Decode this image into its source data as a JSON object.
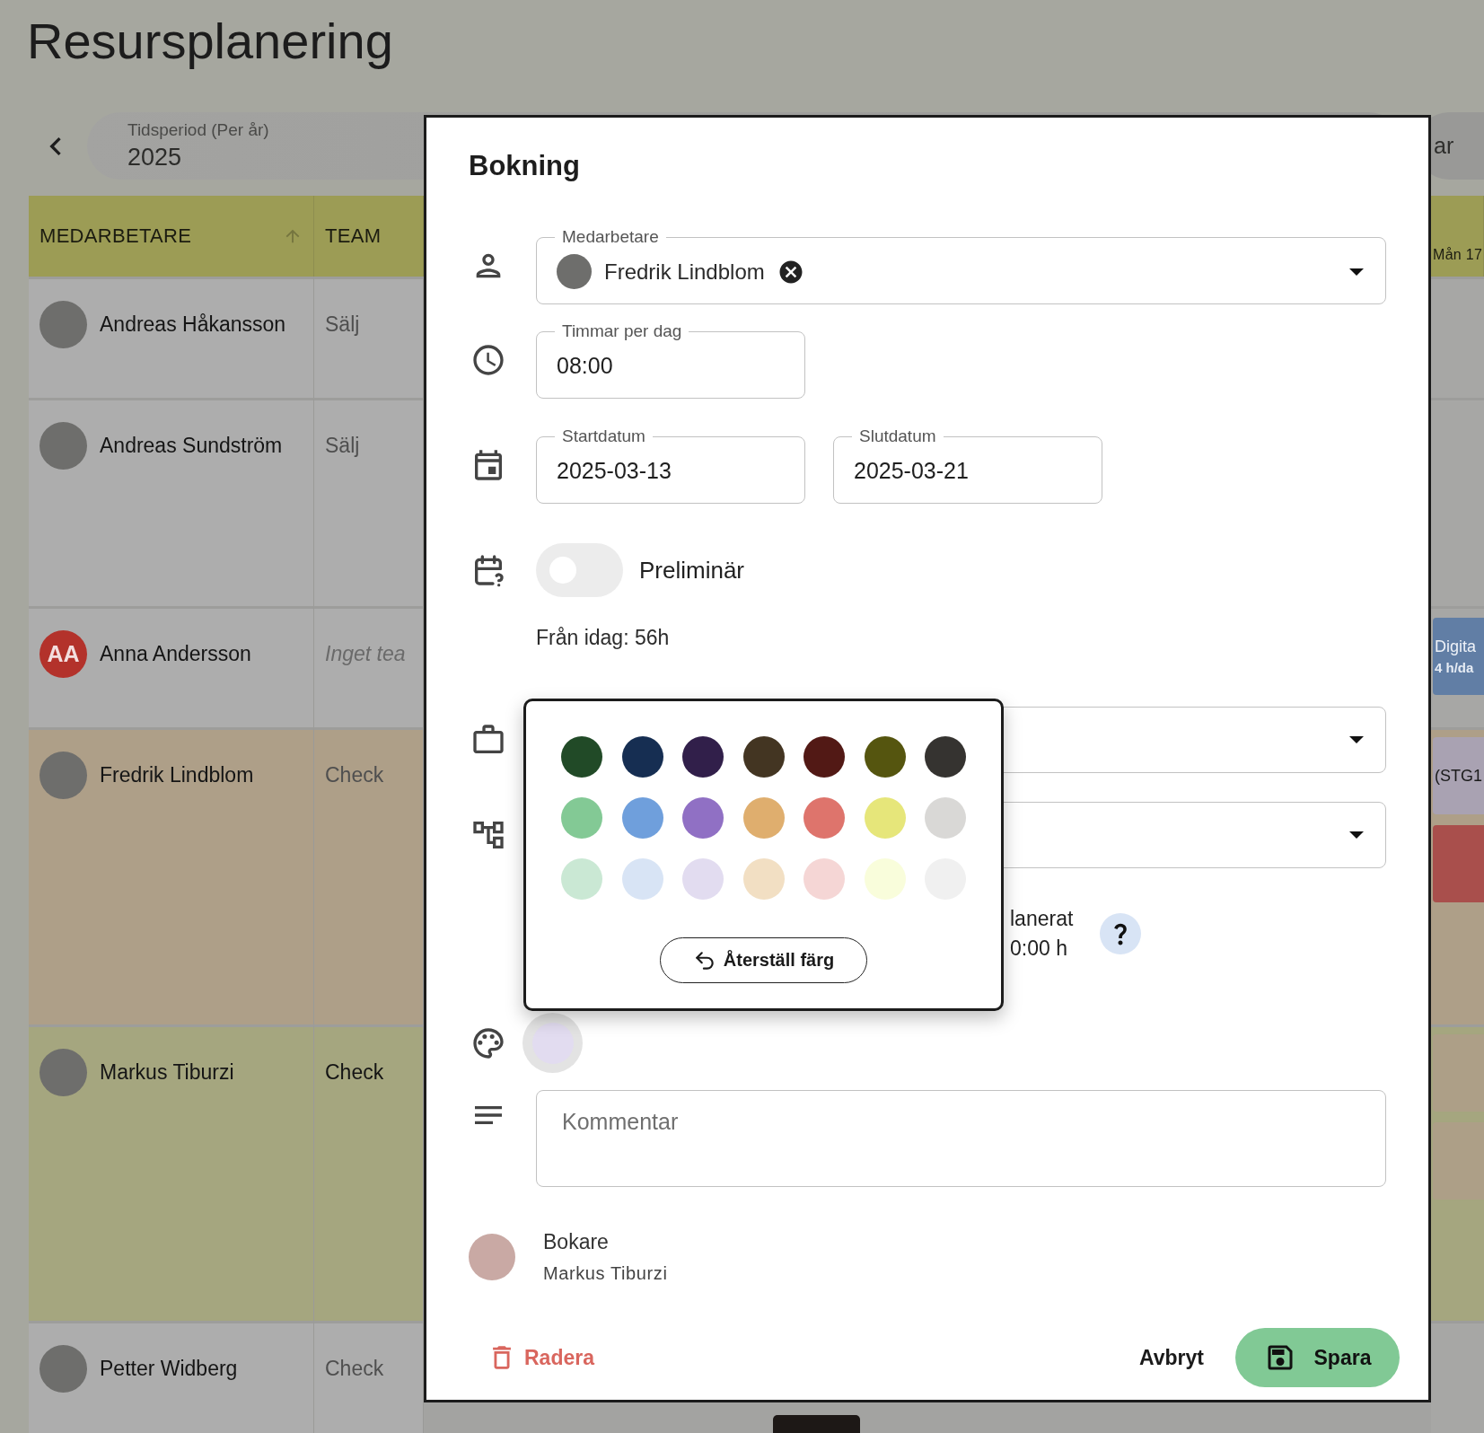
{
  "page": {
    "title": "Resursplanering"
  },
  "toolbar": {
    "period_label": "Tidsperiod (Per år)",
    "period_value": "2025",
    "right_button": "ar"
  },
  "table": {
    "columns": [
      {
        "label": "MEDARBETARE",
        "sorted": true
      },
      {
        "label": "TEAM",
        "sorted": false
      }
    ],
    "calendar_header": "Mån 17",
    "rows": [
      {
        "name": "Andreas Håkansson",
        "avatar": {
          "kind": "photo"
        },
        "team": {
          "text": "Sälj",
          "kind": "muted"
        },
        "color": "#adadad",
        "bookings": []
      },
      {
        "name": "Andreas Sundström",
        "avatar": {
          "kind": "photo"
        },
        "team": {
          "text": "Sälj",
          "kind": "muted"
        },
        "color": "#adadad",
        "bookings": []
      },
      {
        "name": "Anna Andersson",
        "avatar": {
          "kind": "initials",
          "initials": "AA"
        },
        "team": {
          "text": "Inget tea",
          "kind": "empty"
        },
        "color": "#adadad",
        "bookings": [
          {
            "title": "Digita",
            "subtitle": "4 h/da",
            "color": "#617ea5"
          }
        ]
      },
      {
        "name": "Fredrik Lindblom",
        "avatar": {
          "kind": "photo"
        },
        "team": {
          "text": "Check",
          "kind": "muted"
        },
        "color": "#ae9f88",
        "bookings": [
          {
            "title": "(STG1",
            "color": "#a9a2b2"
          },
          {
            "color": "#a94f4c"
          }
        ]
      },
      {
        "name": "Markus Tiburzi",
        "avatar": {
          "kind": "photo"
        },
        "team": {
          "text": "Check",
          "kind": "strong"
        },
        "color": "#a5a67f",
        "bookings": [
          {
            "color": "#ad9f87"
          },
          {
            "color": "#ad9f87"
          }
        ]
      },
      {
        "name": "Petter Widberg",
        "avatar": {
          "kind": "photo"
        },
        "team": {
          "text": "Check",
          "kind": "muted"
        },
        "color": "#adadad",
        "bookings": [],
        "hidden_bookings": [
          {
            "color": "#1d1816"
          }
        ]
      }
    ]
  },
  "dialog": {
    "title": "Bokning",
    "employee_field": {
      "label": "Medarbetare",
      "value": "Fredrik Lindblom"
    },
    "hours_field": {
      "label": "Timmar per dag",
      "value": "08:00"
    },
    "start_field": {
      "label": "Startdatum",
      "value": "2025-03-13"
    },
    "end_field": {
      "label": "Slutdatum",
      "value": "2025-03-21"
    },
    "preliminary": {
      "label": "Preliminär",
      "on": false
    },
    "remaining": "Från idag: 56h",
    "planned": {
      "label": "lanerat",
      "value": "0:00 h"
    },
    "color_field": {
      "color": "#e2dcf0"
    },
    "color_picker": {
      "swatches": [
        {
          "color": "#214a27"
        },
        {
          "color": "#162e52"
        },
        {
          "color": "#311f4a"
        },
        {
          "color": "#433522"
        },
        {
          "color": "#521915"
        },
        {
          "color": "#55550f"
        },
        {
          "color": "#353330"
        },
        {
          "color": "#83c995"
        },
        {
          "color": "#6f9fdc"
        },
        {
          "color": "#9070c4"
        },
        {
          "color": "#dfae6e"
        },
        {
          "color": "#de746c"
        },
        {
          "color": "#e6e67a"
        },
        {
          "color": "#d9d8d6"
        },
        {
          "color": "#cae8d4"
        },
        {
          "color": "#d8e4f5"
        },
        {
          "color": "#e2dcf0"
        },
        {
          "color": "#f2dfc3"
        },
        {
          "color": "#f5d6d5"
        },
        {
          "color": "#f9fddb"
        },
        {
          "color": "#f0f0f0"
        }
      ],
      "reset_button": "Återställ färg"
    },
    "comment_field": {
      "placeholder": "Kommentar"
    },
    "booker": {
      "label": "Bokare",
      "name": "Markus Tiburzi"
    },
    "buttons": {
      "delete": "Radera",
      "cancel": "Avbryt",
      "save": "Spara"
    }
  }
}
